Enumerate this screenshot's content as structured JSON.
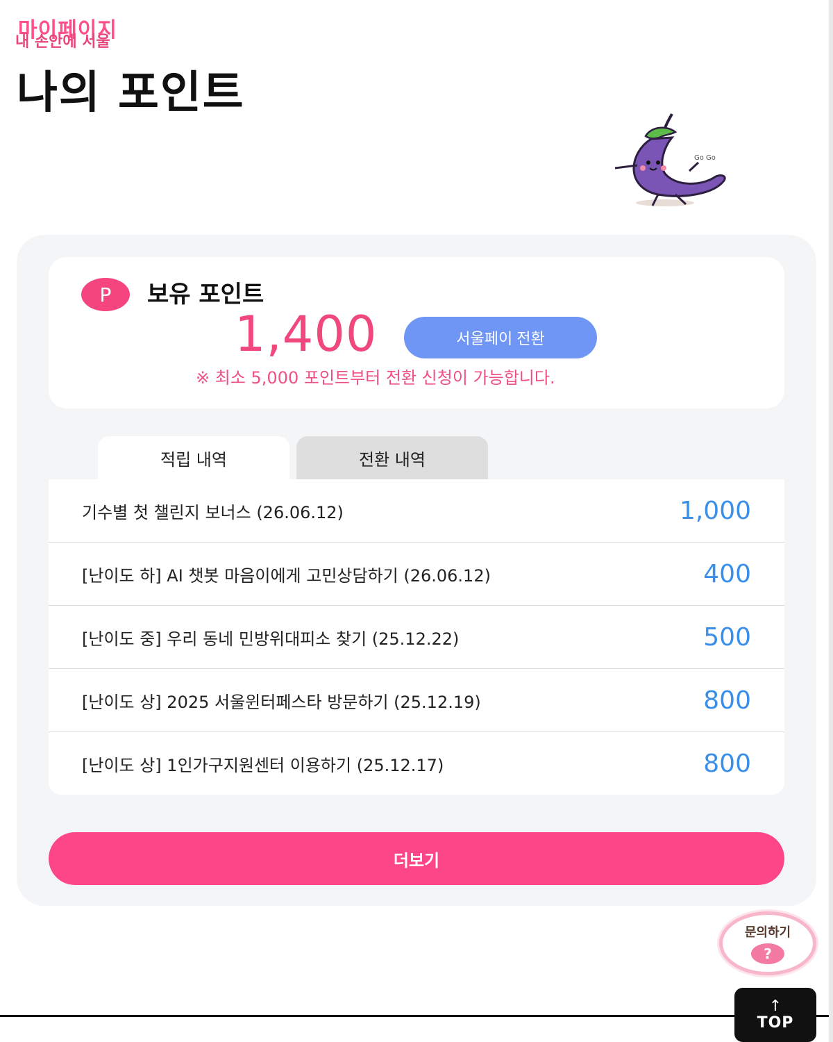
{
  "header": {
    "logo_text_back": "마이페이지",
    "logo_text_front": "내 손안에 서울"
  },
  "page_title": "나의 포인트",
  "mascot": {
    "icon": "eggplant-mascot-icon",
    "caption": "Go Go"
  },
  "points_card": {
    "badge": "P",
    "label": "보유 포인트",
    "value": "1,400",
    "convert_button": "서울페이 전환",
    "notice": "※ 최소 5,000 포인트부터 전환 신청이 가능합니다."
  },
  "tabs": [
    {
      "label": "적립 내역",
      "active": true
    },
    {
      "label": "전환 내역",
      "active": false
    }
  ],
  "history": [
    {
      "title": "기수별 첫 챌린지 보너스 (26.06.12)",
      "points": "1,000"
    },
    {
      "title": "[난이도 하] AI 챗봇 마음이에게 고민상담하기 (26.06.12)",
      "points": "400"
    },
    {
      "title": "[난이도 중] 우리 동네 민방위대피소 찾기 (25.12.22)",
      "points": "500"
    },
    {
      "title": "[난이도 상] 2025 서울윈터페스타 방문하기 (25.12.19)",
      "points": "800"
    },
    {
      "title": "[난이도 상] 1인가구지원센터 이용하기 (25.12.17)",
      "points": "800"
    }
  ],
  "more_button": "더보기",
  "inquiry": {
    "label": "문의하기",
    "icon": "question-icon",
    "symbol": "?"
  },
  "top_button": {
    "arrow": "↑",
    "label": "TOP"
  },
  "colors": {
    "accent_pink": "#fd4686",
    "button_blue": "#6f95f5",
    "points_blue": "#3a8fe8",
    "panel_bg": "#f4f5f7"
  }
}
